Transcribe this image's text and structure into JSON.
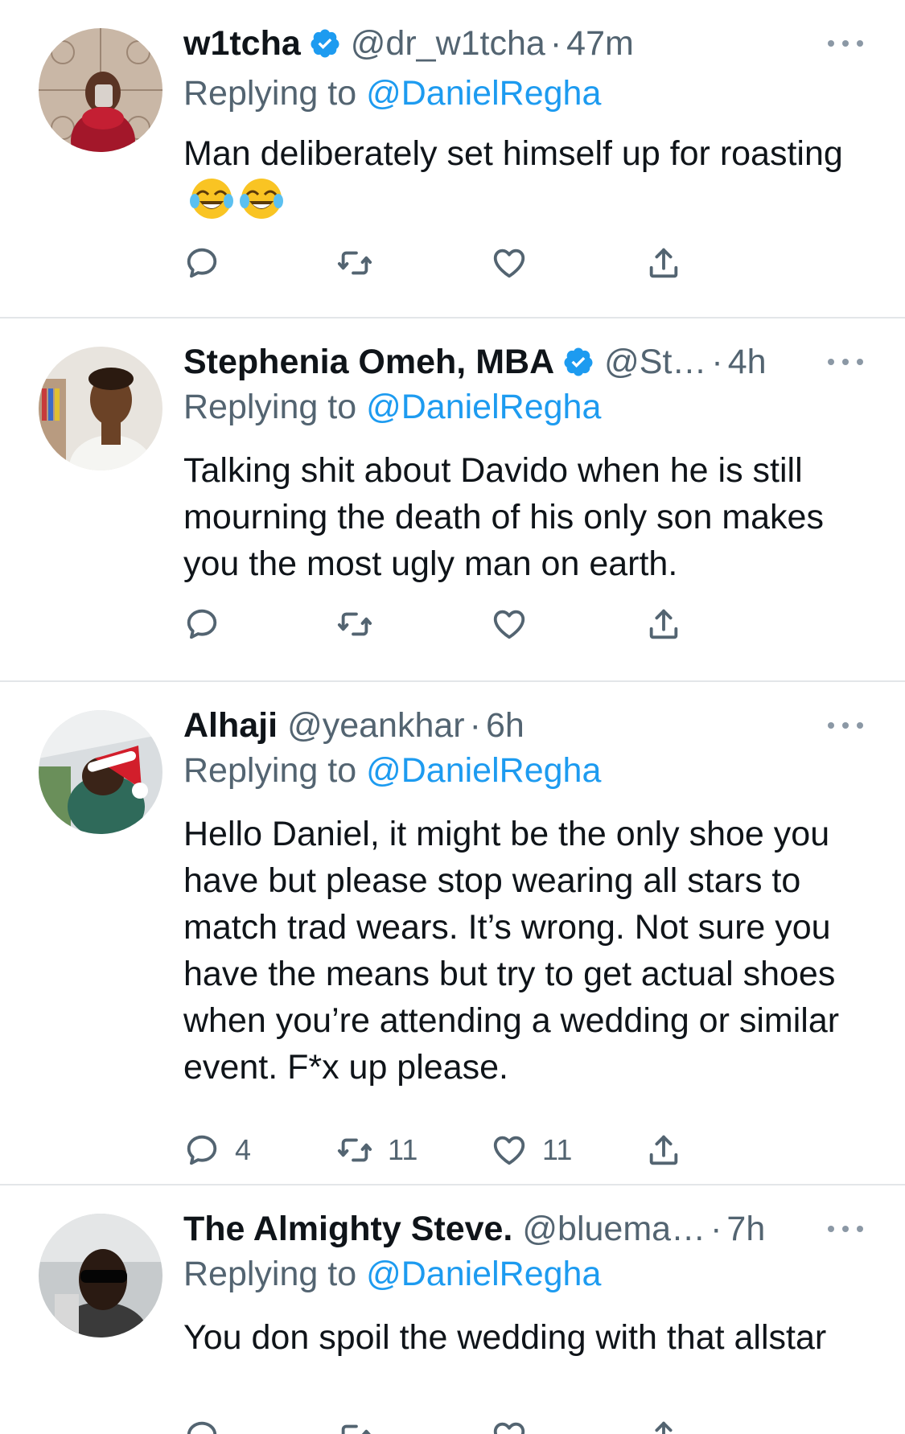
{
  "colors": {
    "accent": "#1d9bf0",
    "verified": "#1d9bf0",
    "secondary_text": "#536471",
    "divider": "#e3e6e9"
  },
  "tweets": [
    {
      "name": "w1tcha",
      "verified": true,
      "handle": "@dr_w1tcha",
      "time": "47m",
      "replying_label": "Replying to",
      "replying_to": "@DanielRegha",
      "text": "Man deliberately set himself up for roasting",
      "emoji": [
        "face-with-tears-of-joy",
        "face-with-tears-of-joy"
      ],
      "counts": {
        "reply": "",
        "retweet": "",
        "like": ""
      }
    },
    {
      "name": "Stephenia Omeh, MBA",
      "verified": true,
      "handle": "@St…",
      "time": "4h",
      "replying_label": "Replying to",
      "replying_to": "@DanielRegha",
      "text": "Talking shit about Davido when he is still mourning the death of his only son makes you the most ugly man on earth.",
      "counts": {
        "reply": "",
        "retweet": "",
        "like": ""
      }
    },
    {
      "name": "Alhaji",
      "verified": false,
      "handle": "@yeankhar",
      "time": "6h",
      "replying_label": "Replying to",
      "replying_to": "@DanielRegha",
      "text": "Hello Daniel, it might be the only shoe you have but please stop wearing all stars to match trad wears. It’s wrong. Not sure you have the means but try to get actual shoes when you’re attending a wedding or similar event. F*x up please.",
      "counts": {
        "reply": "4",
        "retweet": "11",
        "like": "11"
      }
    },
    {
      "name": "The Almighty Steve.",
      "verified": false,
      "handle": "@bluema…",
      "time": "7h",
      "replying_label": "Replying to",
      "replying_to": "@DanielRegha",
      "text": "You don spoil the wedding with that allstar",
      "counts": {
        "reply": "",
        "retweet": "",
        "like": ""
      }
    }
  ],
  "icons": {
    "reply": "reply-icon",
    "retweet": "retweet-icon",
    "like": "heart-icon",
    "share": "share-icon",
    "more": "more-options-icon",
    "verified": "verified-badge-icon"
  }
}
